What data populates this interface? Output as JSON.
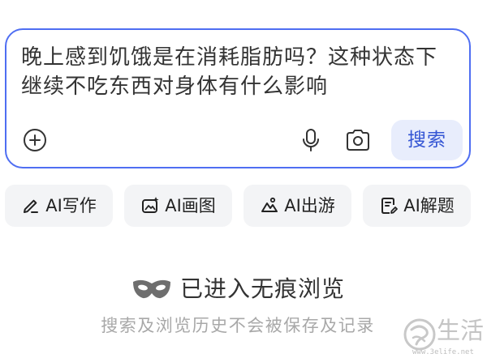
{
  "colors": {
    "accent": "#4f6ef2",
    "button_bg": "#e8edfc",
    "button_text": "#3556d4",
    "pill_bg": "#f3f4f6"
  },
  "search": {
    "query": "晚上感到饥饿是在消耗脂肪吗？这种状态下继续不吃东西对身体有什么影响",
    "add_icon": "plus-circle-icon",
    "voice_icon": "microphone-icon",
    "camera_icon": "camera-icon",
    "submit_label": "搜索"
  },
  "tools": [
    {
      "label": "AI写作",
      "icon": "pen-icon"
    },
    {
      "label": "AI画图",
      "icon": "image-icon"
    },
    {
      "label": "AI出游",
      "icon": "travel-icon"
    },
    {
      "label": "AI解题",
      "icon": "solve-icon"
    }
  ],
  "incognito": {
    "icon": "mask-icon",
    "title": "已进入无痕浏览",
    "note": "搜索及浏览历史不会被保存及记录"
  },
  "watermark": {
    "brand": "生活",
    "url": "www.3elife.net"
  }
}
